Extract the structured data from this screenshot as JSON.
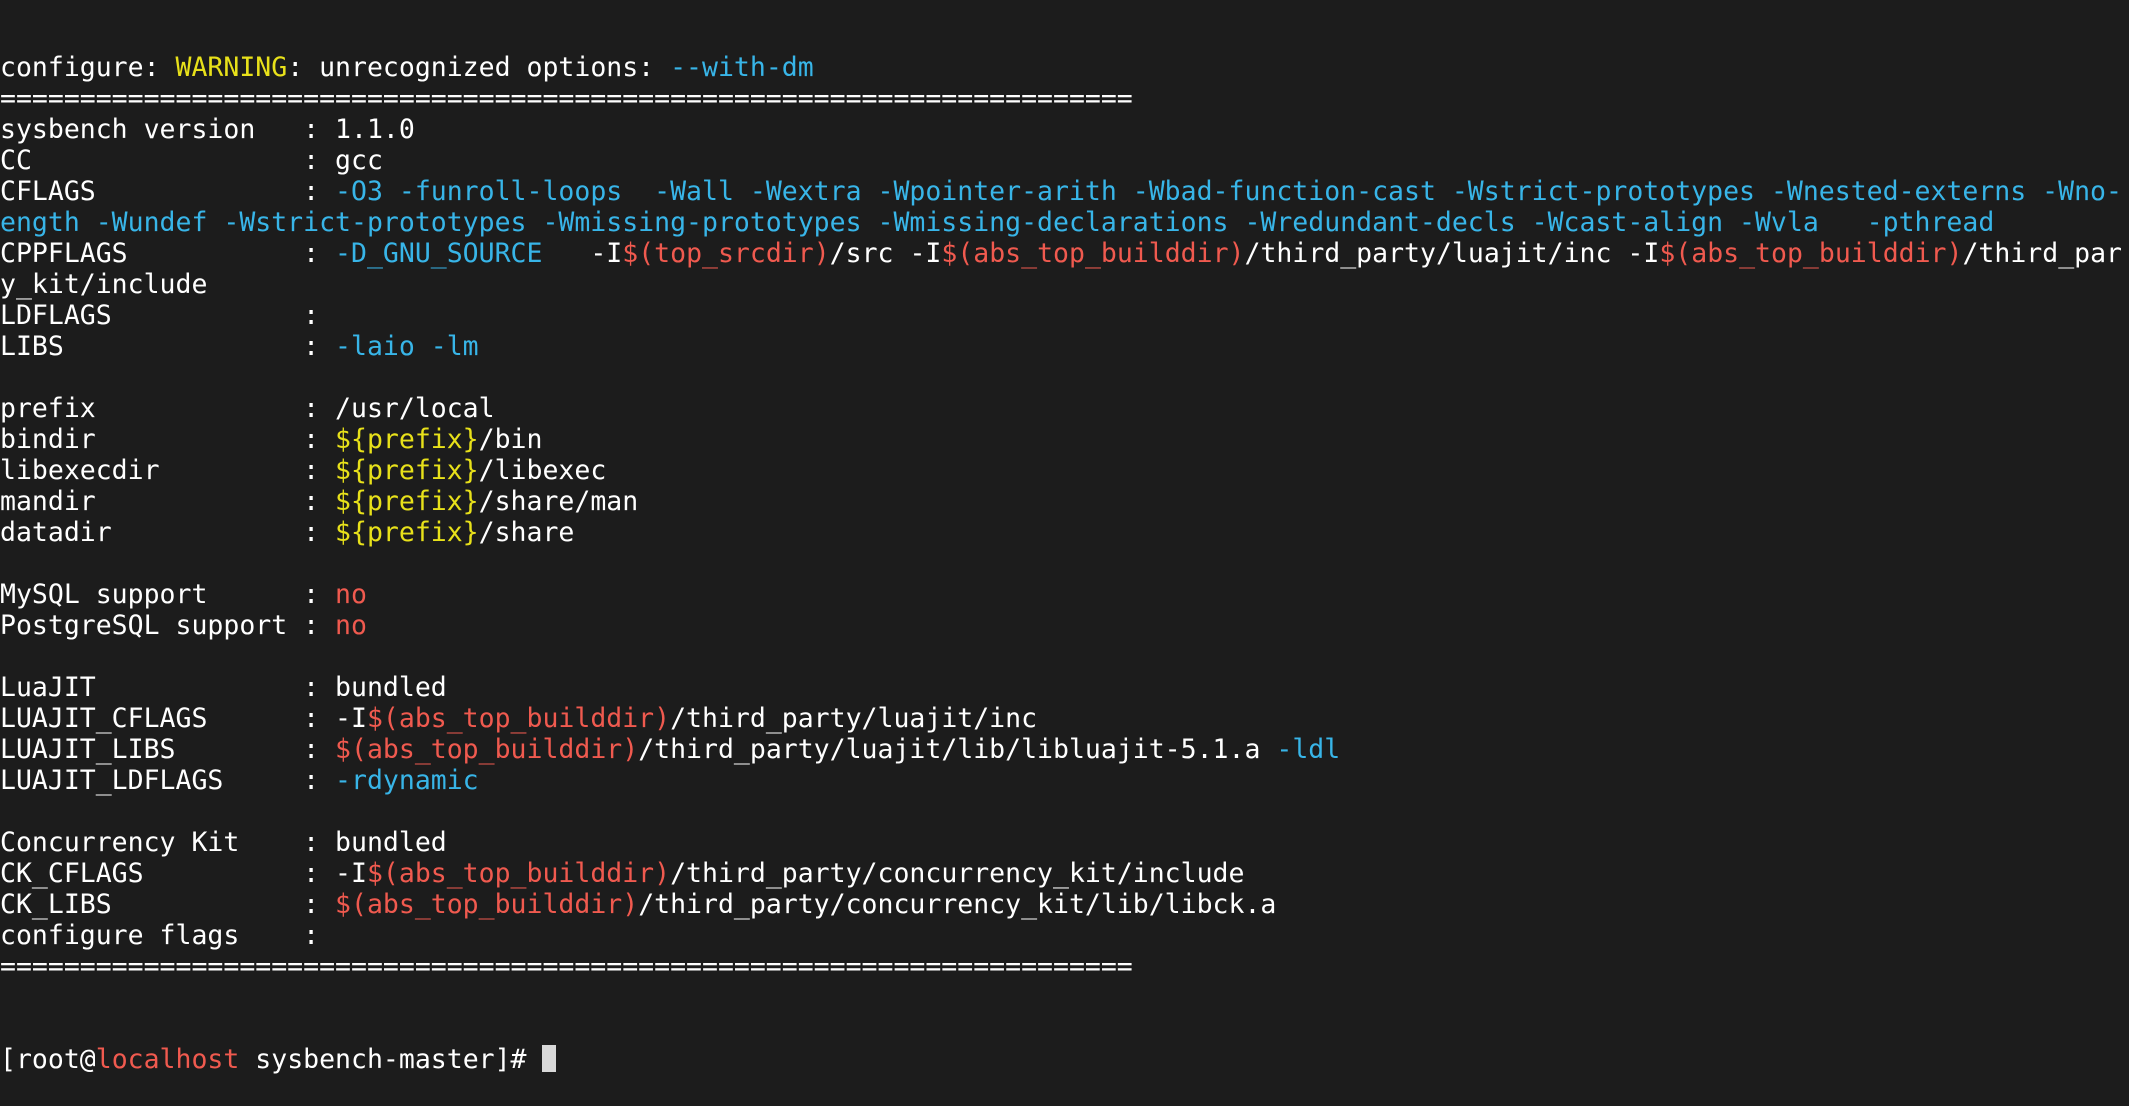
{
  "colors": {
    "background": "#1c1c1c",
    "default": "#ffffff",
    "option": "#38b5e8",
    "variable": "#e8e11a",
    "error": "#f05a4f"
  },
  "lines": [
    [
      {
        "t": "configure: ",
        "c": "white"
      },
      {
        "t": "WARNING",
        "c": "yellow"
      },
      {
        "t": ": unrecognized options: ",
        "c": "white"
      },
      {
        "t": "--with-dm",
        "c": "cyan"
      }
    ],
    [
      {
        "t": "=======================================================================",
        "c": "white"
      }
    ],
    [
      {
        "t": "sysbench version   : 1.1.0",
        "c": "white"
      }
    ],
    [
      {
        "t": "CC                 : gcc",
        "c": "white"
      }
    ],
    [
      {
        "t": "CFLAGS             : ",
        "c": "white"
      },
      {
        "t": "-O3 -funroll-loops  -Wall -Wextra -Wpointer-arith -Wbad-function-cast -Wstrict-prototypes -Wnested-externs -Wno-",
        "c": "cyan"
      }
    ],
    [
      {
        "t": "ength -Wundef -Wstrict-prototypes -Wmissing-prototypes -Wmissing-declarations -Wredundant-decls -Wcast-align -Wvla   -pthread",
        "c": "cyan"
      }
    ],
    [
      {
        "t": "CPPFLAGS           : ",
        "c": "white"
      },
      {
        "t": "-D_GNU_SOURCE",
        "c": "cyan"
      },
      {
        "t": "   -I",
        "c": "white"
      },
      {
        "t": "$(top_srcdir)",
        "c": "red"
      },
      {
        "t": "/src -I",
        "c": "white"
      },
      {
        "t": "$(abs_top_builddir)",
        "c": "red"
      },
      {
        "t": "/third_party/luajit/inc -I",
        "c": "white"
      },
      {
        "t": "$(abs_top_builddir)",
        "c": "red"
      },
      {
        "t": "/third_par",
        "c": "white"
      }
    ],
    [
      {
        "t": "y_kit/include",
        "c": "white"
      }
    ],
    [
      {
        "t": "LDFLAGS            :",
        "c": "white"
      }
    ],
    [
      {
        "t": "LIBS               : ",
        "c": "white"
      },
      {
        "t": "-laio -lm",
        "c": "cyan"
      }
    ],
    [
      {
        "t": "",
        "c": "white"
      }
    ],
    [
      {
        "t": "prefix             : /usr/local",
        "c": "white"
      }
    ],
    [
      {
        "t": "bindir             : ",
        "c": "white"
      },
      {
        "t": "${prefix}",
        "c": "yellow"
      },
      {
        "t": "/bin",
        "c": "white"
      }
    ],
    [
      {
        "t": "libexecdir         : ",
        "c": "white"
      },
      {
        "t": "${prefix}",
        "c": "yellow"
      },
      {
        "t": "/libexec",
        "c": "white"
      }
    ],
    [
      {
        "t": "mandir             : ",
        "c": "white"
      },
      {
        "t": "${prefix}",
        "c": "yellow"
      },
      {
        "t": "/share/man",
        "c": "white"
      }
    ],
    [
      {
        "t": "datadir            : ",
        "c": "white"
      },
      {
        "t": "${prefix}",
        "c": "yellow"
      },
      {
        "t": "/share",
        "c": "white"
      }
    ],
    [
      {
        "t": "",
        "c": "white"
      }
    ],
    [
      {
        "t": "MySQL support      : ",
        "c": "white"
      },
      {
        "t": "no",
        "c": "red"
      }
    ],
    [
      {
        "t": "PostgreSQL support : ",
        "c": "white"
      },
      {
        "t": "no",
        "c": "red"
      }
    ],
    [
      {
        "t": "",
        "c": "white"
      }
    ],
    [
      {
        "t": "LuaJIT             : bundled",
        "c": "white"
      }
    ],
    [
      {
        "t": "LUAJIT_CFLAGS      : -I",
        "c": "white"
      },
      {
        "t": "$(abs_top_builddir)",
        "c": "red"
      },
      {
        "t": "/third_party/luajit/inc",
        "c": "white"
      }
    ],
    [
      {
        "t": "LUAJIT_LIBS        : ",
        "c": "white"
      },
      {
        "t": "$(abs_top_builddir)",
        "c": "red"
      },
      {
        "t": "/third_party/luajit/lib/libluajit-5.1.a ",
        "c": "white"
      },
      {
        "t": "-ldl",
        "c": "cyan"
      }
    ],
    [
      {
        "t": "LUAJIT_LDFLAGS     : ",
        "c": "white"
      },
      {
        "t": "-rdynamic",
        "c": "cyan"
      }
    ],
    [
      {
        "t": "",
        "c": "white"
      }
    ],
    [
      {
        "t": "Concurrency Kit    : bundled",
        "c": "white"
      }
    ],
    [
      {
        "t": "CK_CFLAGS          : -I",
        "c": "white"
      },
      {
        "t": "$(abs_top_builddir)",
        "c": "red"
      },
      {
        "t": "/third_party/concurrency_kit/include",
        "c": "white"
      }
    ],
    [
      {
        "t": "CK_LIBS            : ",
        "c": "white"
      },
      {
        "t": "$(abs_top_builddir)",
        "c": "red"
      },
      {
        "t": "/third_party/concurrency_kit/lib/libck.a",
        "c": "white"
      }
    ],
    [
      {
        "t": "configure flags    :",
        "c": "white"
      }
    ],
    [
      {
        "t": "=======================================================================",
        "c": "white"
      }
    ]
  ],
  "prompt": {
    "open": "[root@",
    "host": "localhost",
    "rest": " sysbench-master]# "
  }
}
